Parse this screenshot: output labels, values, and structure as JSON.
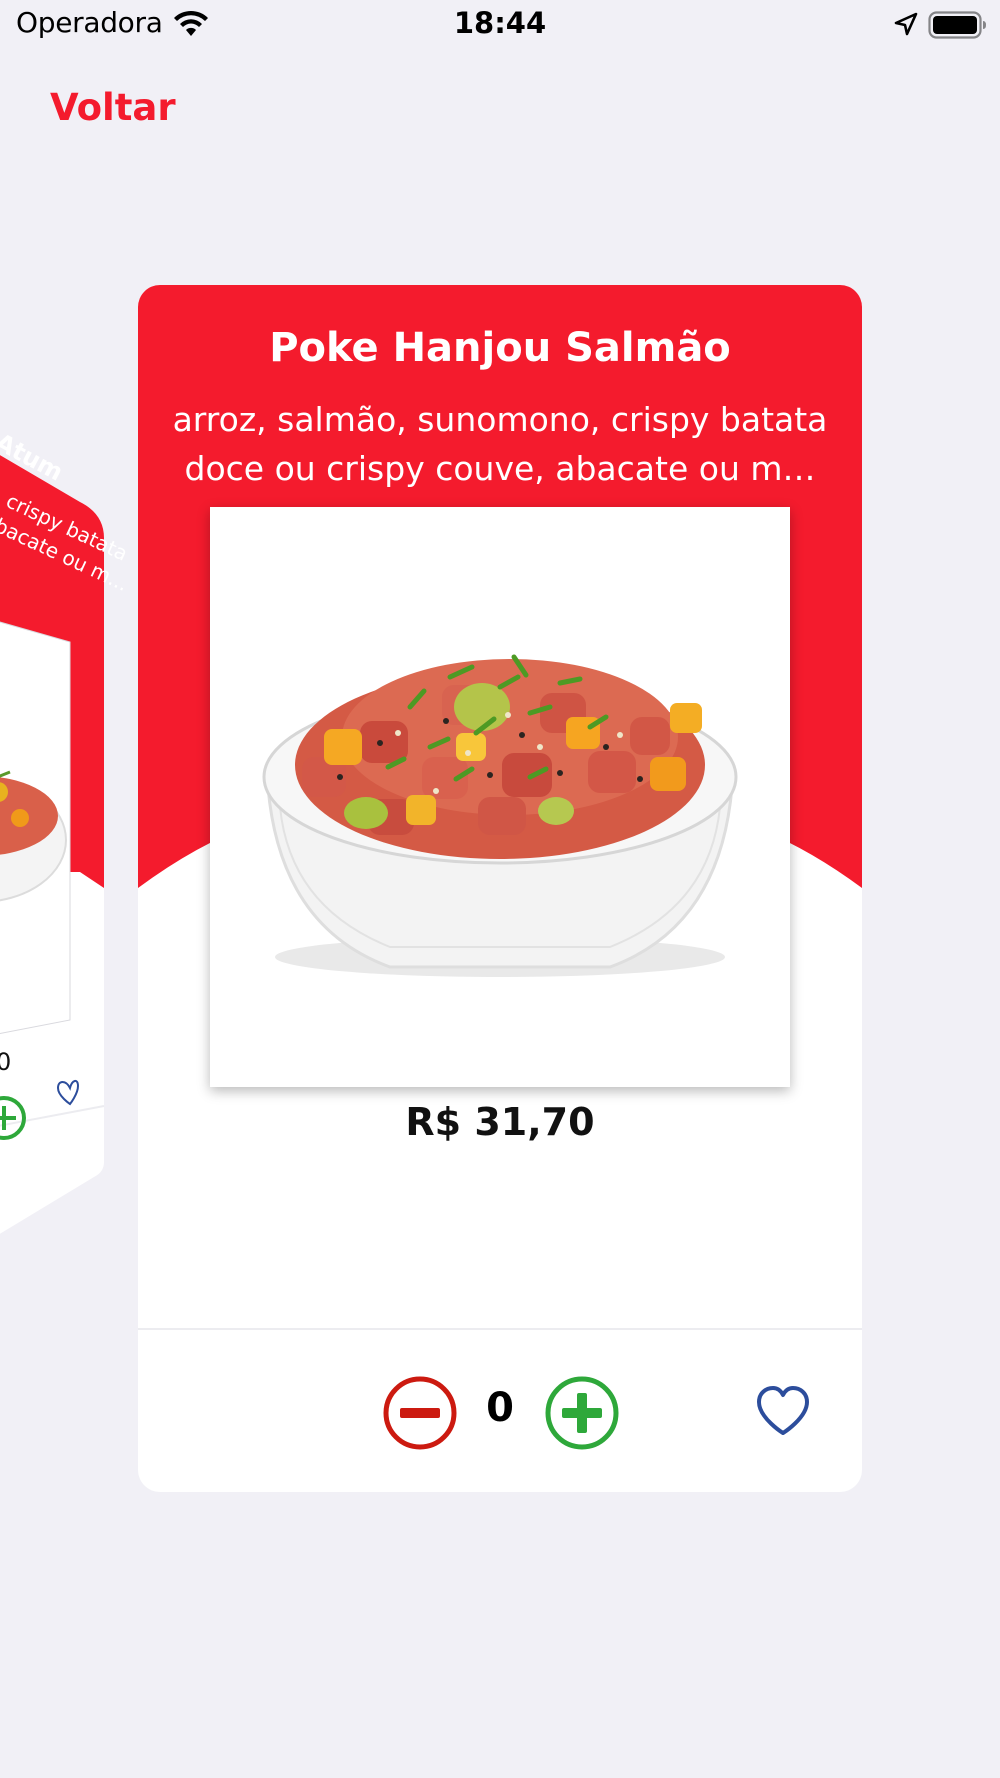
{
  "status_bar": {
    "carrier": "Operadora",
    "time": "18:44",
    "icons": [
      "wifi-icon",
      "location-arrow-icon",
      "battery-icon"
    ]
  },
  "nav": {
    "back_label": "Voltar"
  },
  "side_card": {
    "title_fragment": "Atum",
    "desc_line1": "o, crispy batata",
    "desc_line2": "abacate ou m...",
    "price_fragment": "0"
  },
  "product": {
    "name": "Poke Hanjou Salmão",
    "description": "arroz, salmão, sunomono, crispy batata doce ou crispy couve, abacate ou m…",
    "price": "R$ 31,70",
    "quantity": "0",
    "image_alt": "poke bowl"
  },
  "colors": {
    "accent": "#f41b2d",
    "minus": "#cc1a10",
    "plus": "#2ea83a",
    "favorite": "#2c4d9c",
    "background": "#f1f0f6"
  }
}
